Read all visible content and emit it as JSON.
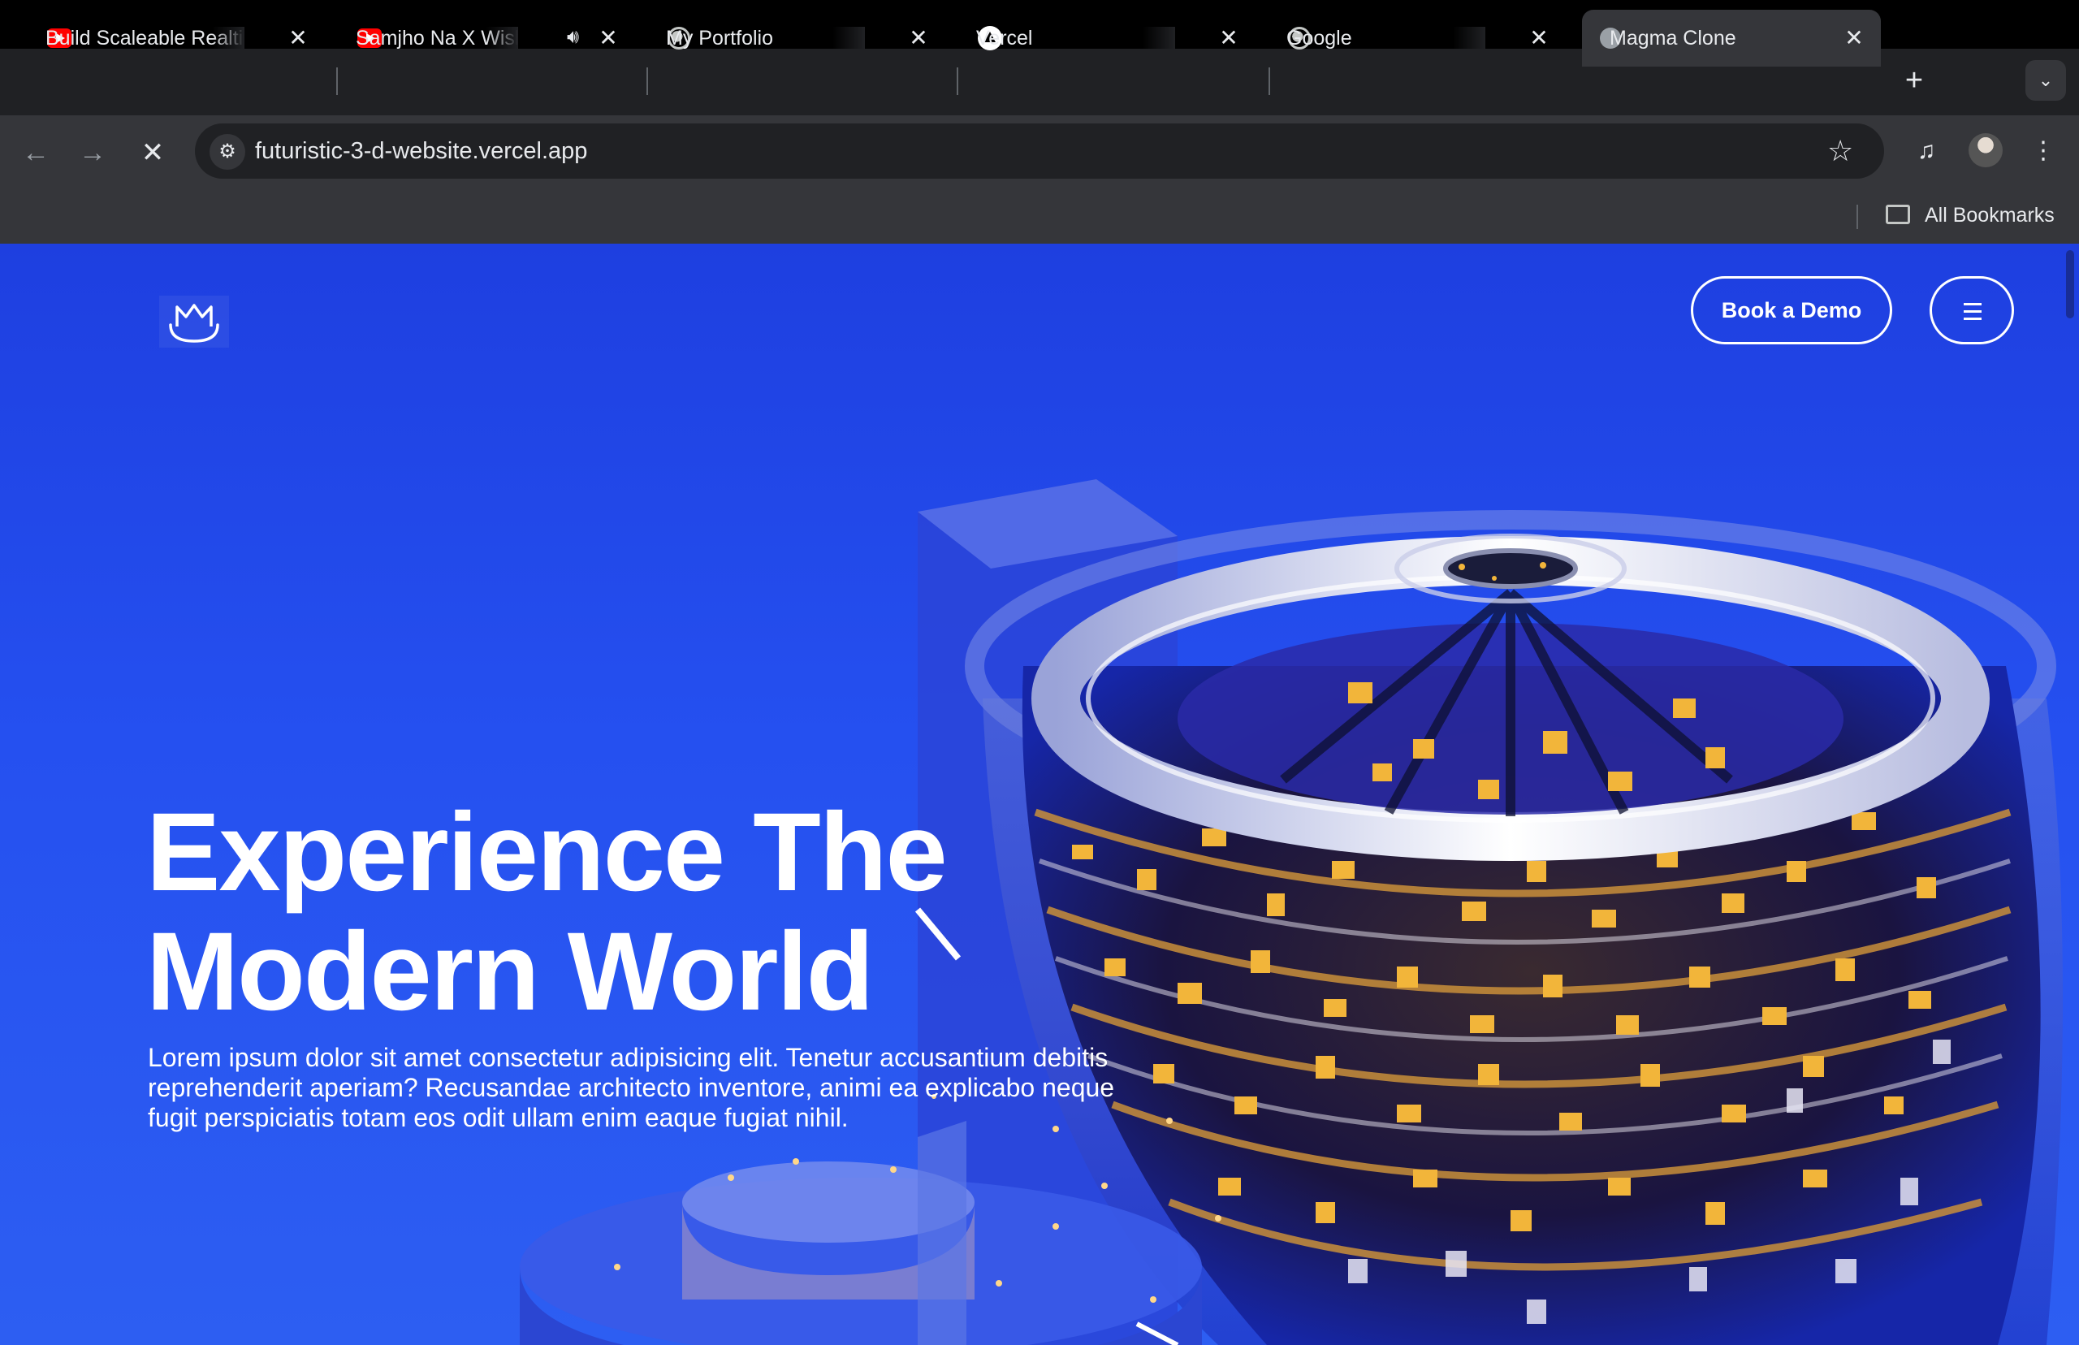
{
  "tabs": [
    {
      "title": "Build Scaleable Realtime",
      "favicon": "youtube-icon",
      "audio": false,
      "active": false
    },
    {
      "title": "Samjho Na X Wishes",
      "favicon": "youtube-icon",
      "audio": true,
      "active": false
    },
    {
      "title": "My Portfolio",
      "favicon": "globe-icon",
      "audio": false,
      "active": false
    },
    {
      "title": "Vercel",
      "favicon": "vercel-icon",
      "audio": false,
      "active": false
    },
    {
      "title": "Google",
      "favicon": "globe-icon",
      "audio": false,
      "active": false
    },
    {
      "title": "Magma Clone",
      "favicon": "loading-icon",
      "audio": false,
      "active": true
    }
  ],
  "toolbar": {
    "url": "futuristic-3-d-website.vercel.app"
  },
  "bookmarks": {
    "all_label": "All Bookmarks"
  },
  "page": {
    "cta_label": "Book a Demo",
    "hero_title_line1": "Experience The",
    "hero_title_line2": "Modern World",
    "hero_text": "Lorem ipsum dolor sit amet consectetur adipisicing elit. Tenetur accusantium debitis reprehenderit aperiam? Recusandae architecto inventore, animi ea explicabo neque fugit perspiciatis totam eos odit ullam enim eaque fugiat nihil."
  },
  "colors": {
    "page_bg": "#2550f0",
    "chrome_dark": "#202124",
    "chrome_toolbar": "#35363a",
    "window_light": "#f2b53a"
  }
}
